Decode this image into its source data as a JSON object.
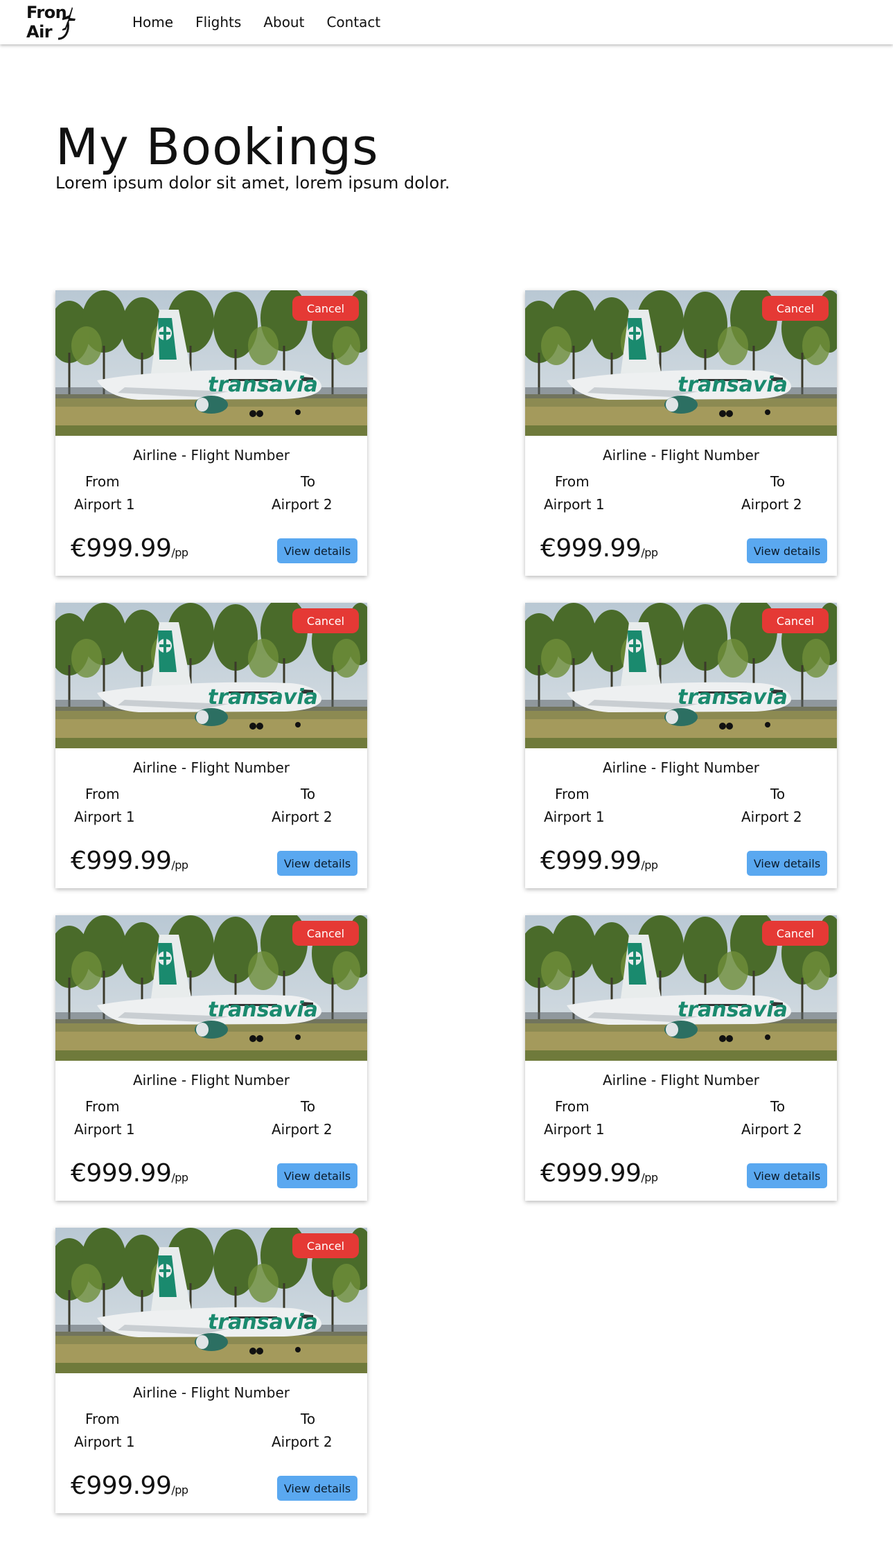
{
  "nav": {
    "logo_text": "Front Air",
    "links": [
      "Home",
      "Flights",
      "About",
      "Contact"
    ]
  },
  "hero": {
    "title": "My Bookings",
    "subtitle": "Lorem ipsum dolor sit amet, lorem ipsum dolor."
  },
  "bookings": [
    {
      "cancel": "Cancel",
      "title": "Airline - Flight Number",
      "from_label": "From",
      "to_label": "To",
      "from_airport": "Airport 1",
      "to_airport": "Airport 2",
      "price": "€999.99",
      "per": "/pp",
      "details": "View details",
      "image_text": "transavia"
    },
    {
      "cancel": "Cancel",
      "title": "Airline - Flight Number",
      "from_label": "From",
      "to_label": "To",
      "from_airport": "Airport 1",
      "to_airport": "Airport 2",
      "price": "€999.99",
      "per": "/pp",
      "details": "View details",
      "image_text": "transavia"
    },
    {
      "cancel": "Cancel",
      "title": "Airline - Flight Number",
      "from_label": "From",
      "to_label": "To",
      "from_airport": "Airport 1",
      "to_airport": "Airport 2",
      "price": "€999.99",
      "per": "/pp",
      "details": "View details",
      "image_text": "transavia"
    },
    {
      "cancel": "Cancel",
      "title": "Airline - Flight Number",
      "from_label": "From",
      "to_label": "To",
      "from_airport": "Airport 1",
      "to_airport": "Airport 2",
      "price": "€999.99",
      "per": "/pp",
      "details": "View details",
      "image_text": "transavia"
    },
    {
      "cancel": "Cancel",
      "title": "Airline - Flight Number",
      "from_label": "From",
      "to_label": "To",
      "from_airport": "Airport 1",
      "to_airport": "Airport 2",
      "price": "€999.99",
      "per": "/pp",
      "details": "View details",
      "image_text": "transavia"
    },
    {
      "cancel": "Cancel",
      "title": "Airline - Flight Number",
      "from_label": "From",
      "to_label": "To",
      "from_airport": "Airport 1",
      "to_airport": "Airport 2",
      "price": "€999.99",
      "per": "/pp",
      "details": "View details",
      "image_text": "transavia"
    },
    {
      "cancel": "Cancel",
      "title": "Airline - Flight Number",
      "from_label": "From",
      "to_label": "To",
      "from_airport": "Airport 1",
      "to_airport": "Airport 2",
      "price": "€999.99",
      "per": "/pp",
      "details": "View details",
      "image_text": "transavia"
    }
  ],
  "colors": {
    "cancel": "#e53935",
    "details": "#5aa8f0",
    "brand_green": "#1a8a6e"
  }
}
